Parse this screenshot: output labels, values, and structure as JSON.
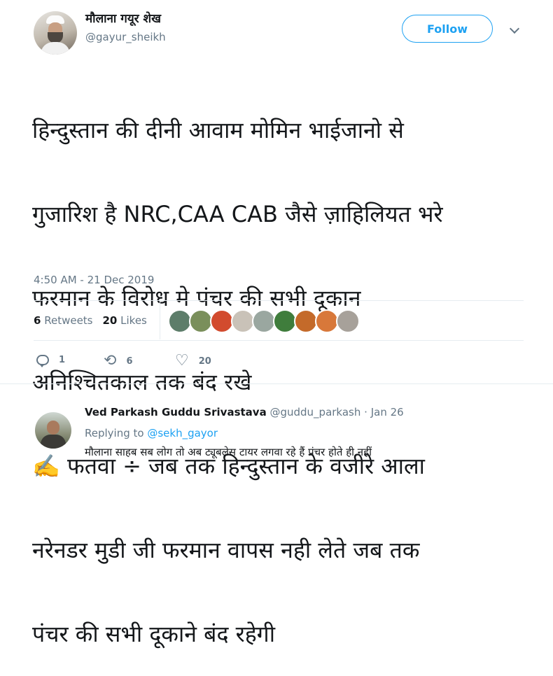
{
  "tweet": {
    "display_name": "मौलाना गयूर शेख",
    "handle": "@gayur_sheikh",
    "follow_label": "Follow",
    "text_lines": [
      "हिन्दुस्तान की दीनी आवाम मोमिन भाईजानो से",
      "गुजारिश है NRC,CAA CAB जैसे ज़ाहिलियत भरे",
      "फरमान के विरोध मे पंचर की सभी दूकान",
      "अनिश्चितकाल तक बंद रखे",
      "✍️ फतवा ÷ जब तक हिन्दुस्तान के वजीरे आला",
      "नरेनडर मुडी जी फरमान वापस नही लेते जब तक",
      "पंचर की सभी दूकाने बंद रहेगी"
    ],
    "timestamp": "4:50 AM - 21 Dec 2019",
    "retweets_count": "6",
    "retweets_label": "Retweets",
    "likes_count": "20",
    "likes_label": "Likes",
    "actions": {
      "reply_count": "1",
      "retweet_count": "6",
      "like_count": "20"
    }
  },
  "reply": {
    "display_name": "Ved Parkash Guddu Srivastava",
    "handle": "@guddu_parkash",
    "separator": "·",
    "date": "Jan 26",
    "replying_prefix": "Replying to",
    "replying_mention": "@sekh_gayor",
    "text": "मौलाना साहब सब लोग तो अब ट्यूबलेस टायर लगवा रहे हैं पंचर होते ही नहीं"
  },
  "colors": {
    "accent": "#1da1f2",
    "muted": "#657786",
    "text": "#14171a",
    "divider": "#e6ecf0"
  },
  "icons": [
    "chevron-down-icon",
    "reply-icon",
    "retweet-icon",
    "heart-icon",
    "writing-hand-icon"
  ],
  "likers": [
    "#5d7d6a",
    "#7a8f5b",
    "#d24b2e",
    "#c9c2b8",
    "#9aa7a0",
    "#3f7d3c",
    "#c46a2a",
    "#d8783a",
    "#a7a19a"
  ]
}
